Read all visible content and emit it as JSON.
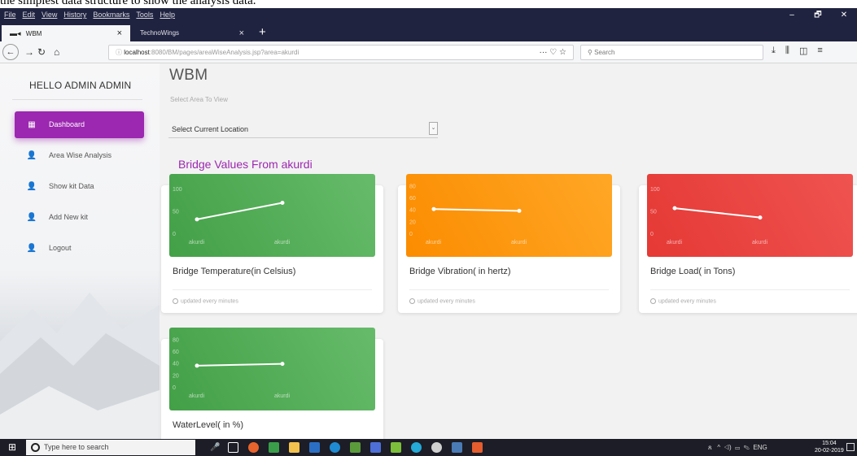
{
  "caption": "the simplest data structure to show the analysis data.",
  "browser": {
    "menus": [
      "File",
      "Edit",
      "View",
      "History",
      "Bookmarks",
      "Tools",
      "Help"
    ],
    "window_controls": [
      "–",
      "🗗",
      "✕"
    ],
    "tabs": [
      {
        "label": "WBM",
        "active": true,
        "close": "×"
      },
      {
        "label": "TechnoWings",
        "active": false,
        "close": "×"
      }
    ],
    "new_tab": "+",
    "url_host": "localhost",
    "url_rest": ":8080/BM/pages/areaWiseAnalysis.jsp?area=akurdi",
    "url_actions": "··· ♡ ☆",
    "search_placeholder": "Search"
  },
  "sidebar": {
    "greeting": "HELLO ADMIN ADMIN",
    "items": [
      {
        "label": "Dashboard",
        "icon": "dashboard-icon",
        "active": true
      },
      {
        "label": "Area Wise Analysis",
        "icon": "person-icon",
        "active": false
      },
      {
        "label": "Show kit Data",
        "icon": "person-icon",
        "active": false
      },
      {
        "label": "Add New kit",
        "icon": "person-icon",
        "active": false
      },
      {
        "label": "Logout",
        "icon": "person-icon",
        "active": false
      }
    ]
  },
  "main": {
    "title": "WBM",
    "subtitle": "Select Area To View",
    "location_select": "Select Current Location",
    "section_title": "Bridge Values From akurdi",
    "footer_text": "updated every minutes"
  },
  "chart_data": [
    {
      "type": "line",
      "color": "#4caf50",
      "title": "Bridge Temperature(in Celsius)",
      "categories": [
        "akurdi",
        "akurdi"
      ],
      "values": [
        33,
        70
      ],
      "yticks": [
        0,
        50,
        100
      ],
      "ylim": [
        0,
        120
      ]
    },
    {
      "type": "line",
      "color": "#fb8c00",
      "title": "Bridge Vibration( in hertz)",
      "categories": [
        "akurdi",
        "akurdi"
      ],
      "values": [
        42,
        39
      ],
      "yticks": [
        0,
        20,
        40,
        60,
        80
      ],
      "ylim": [
        0,
        90
      ]
    },
    {
      "type": "line",
      "color": "#e53935",
      "title": "Bridge Load( in Tons)",
      "categories": [
        "akurdi",
        "akurdi"
      ],
      "values": [
        58,
        37
      ],
      "yticks": [
        0,
        50,
        100
      ],
      "ylim": [
        0,
        120
      ]
    },
    {
      "type": "line",
      "color": "#4caf50",
      "title": "WaterLevel( in %)",
      "categories": [
        "akurdi",
        "akurdi"
      ],
      "values": [
        37,
        40
      ],
      "yticks": [
        0,
        20,
        40,
        60,
        80
      ],
      "ylim": [
        0,
        90
      ]
    }
  ],
  "taskbar": {
    "search_placeholder": "Type here to search",
    "language": "ENG",
    "time": "15:04",
    "date": "20-02-2019"
  }
}
